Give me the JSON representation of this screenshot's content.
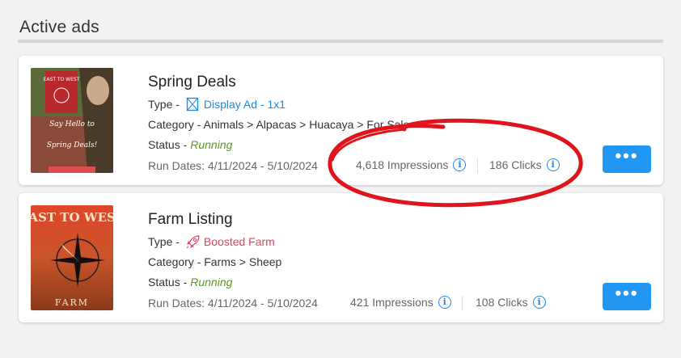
{
  "section": {
    "title": "Active ads"
  },
  "ads": [
    {
      "title": "Spring Deals",
      "type_prefix": "Type -",
      "type_label": "Display Ad - 1x1",
      "type_icon": "display-ad-icon",
      "category": "Category - Animals > Alpacas > Huacaya > For Sale",
      "status_prefix": "Status -",
      "status": "Running",
      "run_dates": "Run Dates: 4/11/2024 - 5/10/2024",
      "impressions": "4,618 Impressions",
      "clicks": "186 Clicks",
      "more_label": "•••",
      "thumb_text_top": "EAST TO WEST",
      "thumb_text_main": "Say Hello to Spring Deals!"
    },
    {
      "title": "Farm Listing",
      "type_prefix": "Type -",
      "type_label": "Boosted Farm",
      "type_icon": "rocket-icon",
      "category": "Category - Farms > Sheep",
      "status_prefix": "Status -",
      "status": "Running",
      "run_dates": "Run Dates: 4/11/2024 - 5/10/2024",
      "impressions": "421 Impressions",
      "clicks": "108 Clicks",
      "more_label": "•••",
      "thumb_text_top": "EAST TO WEST",
      "thumb_text_bottom": "FARM"
    }
  ],
  "colors": {
    "accent": "#2196f3",
    "link_blue": "#1e88e5",
    "link_red": "#e5405e",
    "running": "#5a9a1e",
    "annotation": "#e0141c"
  }
}
